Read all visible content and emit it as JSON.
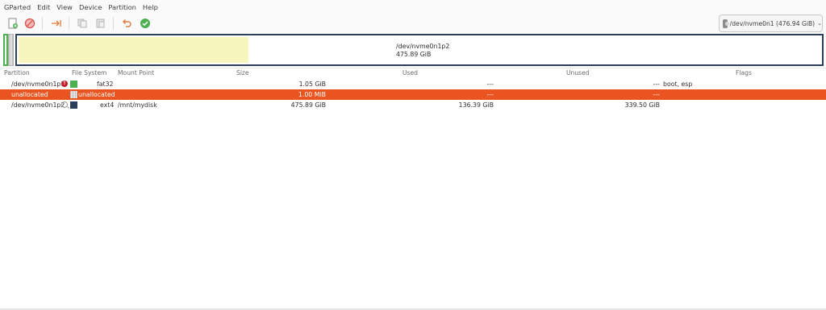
{
  "menu": [
    "GParted",
    "Edit",
    "View",
    "Device",
    "Partition",
    "Help"
  ],
  "toolbar": {
    "icons": [
      "new-partition-icon",
      "delete-partition-icon",
      "resize-move-icon",
      "copy-icon",
      "paste-icon",
      "undo-icon",
      "apply-icon"
    ]
  },
  "device_selector": {
    "value": "/dev/nvme0n1 (476.94 GiB)"
  },
  "disk_graphic": {
    "p2_name": "/dev/nvme0n1p2",
    "p2_size": "475.89 GiB",
    "p2_used_fraction": 0.287
  },
  "table": {
    "headers": [
      "Partition",
      "File System",
      "Mount Point",
      "Size",
      "Used",
      "Unused",
      "Flags"
    ],
    "rows": [
      {
        "partition": "/dev/nvme0n1p1",
        "fs": "fat32",
        "mount": "",
        "size": "1.05 GiB",
        "used": "---",
        "unused": "---",
        "flags": "boot, esp",
        "fs_color": "#4caf50"
      },
      {
        "partition": "unallocated",
        "fs": "unallocated",
        "mount": "",
        "size": "1.00 MiB",
        "used": "---",
        "unused": "---",
        "flags": "",
        "fs_color": "#bdbdbd"
      },
      {
        "partition": "/dev/nvme0n1p2",
        "fs": "ext4",
        "mount": "/mnt/mydisk",
        "size": "475.89 GiB",
        "used": "136.39 GiB",
        "unused": "339.50 GiB",
        "flags": "",
        "fs_color": "#2b3f5c"
      }
    ]
  }
}
